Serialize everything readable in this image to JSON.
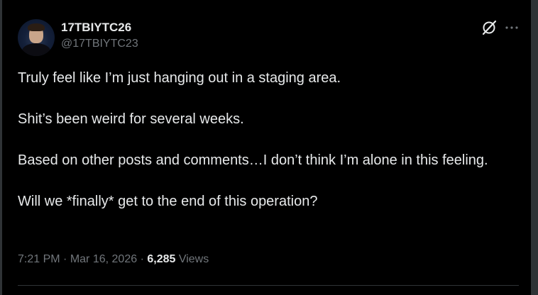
{
  "author": {
    "display_name": "17TBIYTC26",
    "handle": "@17TBIYTC23"
  },
  "post": {
    "paragraphs": [
      "Truly feel like I’m just hanging out in a staging area.",
      "Shit’s been weird for several weeks.",
      "Based on other posts and comments…I don’t think I’m alone in this feeling.",
      "Will we *finally* get to the end of this operation?"
    ]
  },
  "meta": {
    "time": "7:21 PM",
    "separator": "·",
    "date": "Mar 16, 2026",
    "views_count": "6,285",
    "views_label": "Views"
  },
  "icons": {
    "grok": "grok-icon",
    "more": "more-icon"
  },
  "colors": {
    "background": "#000000",
    "primary_text": "#e7e9ea",
    "secondary_text": "#71767b",
    "border": "#2f3336"
  }
}
